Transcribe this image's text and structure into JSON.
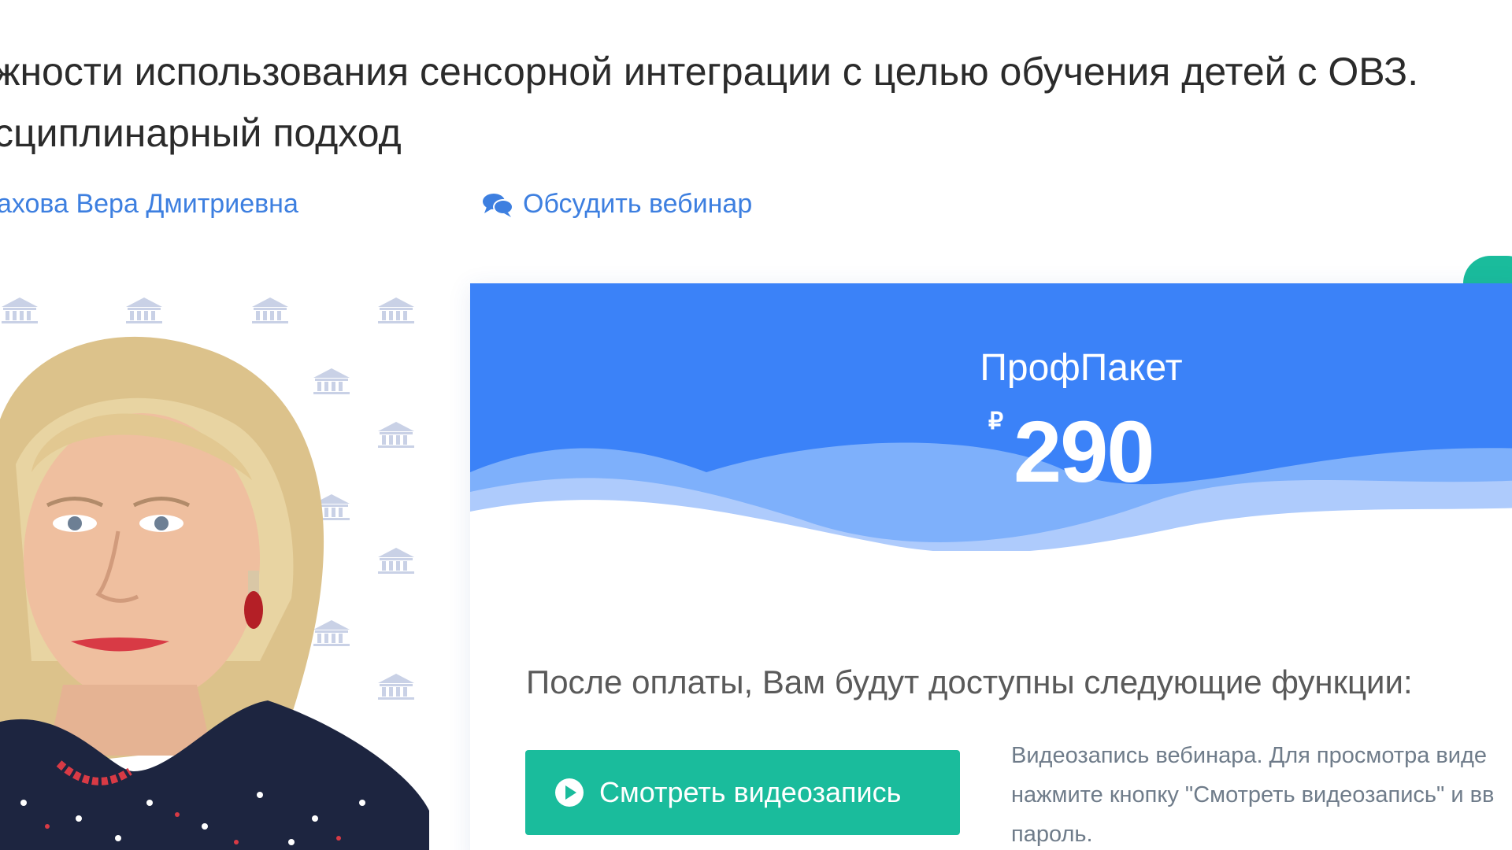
{
  "webinar": {
    "title_lines": [
      "жности использования сенсорной интеграции с целью обучения детей с ОВЗ.",
      "сциплинарный подход"
    ],
    "author": "ахова Вера Дмитриевна",
    "discuss_label": "Обсудить вебинар"
  },
  "plan": {
    "name": "ПрофПакет",
    "currency_symbol": "₽",
    "price": "290",
    "features_heading": "После оплаты, Вам будут доступны следующие функции:",
    "watch_button_label": "Смотреть видеозапись",
    "watch_description_lines": [
      "Видеозапись вебинара. Для просмотра виде",
      "нажмите кнопку \"Смотреть видеозапись\" и вв",
      "пароль."
    ]
  },
  "colors": {
    "link": "#3d7fe0",
    "header_blue": "#3b82f8",
    "accent_green": "#1abc9c"
  },
  "icons": {
    "discuss": "comments-icon",
    "watch": "play-circle-icon",
    "pattern": "institution-logo-icon"
  }
}
